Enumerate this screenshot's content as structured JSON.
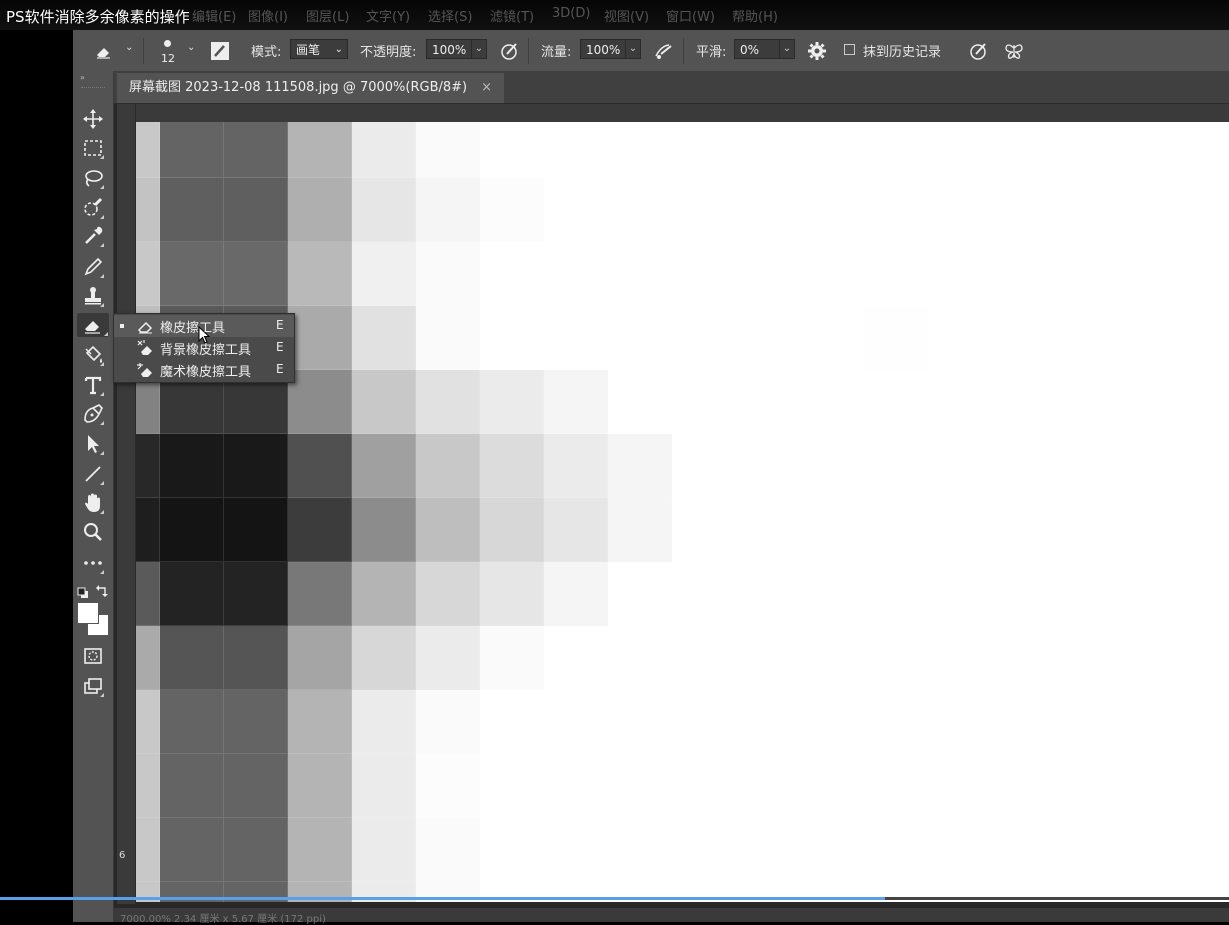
{
  "video_title": "PS软件消除多余像素的操作",
  "menu": {
    "items": [
      "编辑(E)",
      "图像(I)",
      "图层(L)",
      "文字(Y)",
      "选择(S)",
      "滤镜(T)",
      "3D(D)",
      "视图(V)",
      "窗口(W)",
      "帮助(H)"
    ]
  },
  "options_bar": {
    "brush_size": "12",
    "mode_label": "模式:",
    "mode_value": "画笔",
    "opacity_label": "不透明度:",
    "opacity_value": "100%",
    "flow_label": "流量:",
    "flow_value": "100%",
    "smoothing_label": "平滑:",
    "smoothing_value": "0%",
    "erase_history_label": "抹到历史记录",
    "erase_history_checked": false
  },
  "document_tab": {
    "title": "屏幕截图 2023-12-08 111508.jpg @ 7000%(RGB/8#)",
    "close": "×"
  },
  "flyout": {
    "items": [
      {
        "label": "橡皮擦工具",
        "shortcut": "E",
        "selected": true
      },
      {
        "label": "背景橡皮擦工具",
        "shortcut": "E",
        "selected": false
      },
      {
        "label": "魔术橡皮擦工具",
        "shortcut": "E",
        "selected": false
      }
    ]
  },
  "ruler": {
    "vertical_number": "6"
  },
  "status": {
    "text": "7000.00%    2.34 厘米 x 5.67 厘米 (172 ppi)"
  },
  "playback": {
    "progress": 0.72,
    "accent": "#5aa0e6"
  },
  "colors": {
    "foreground": "#ffffff",
    "background": "#ffffff"
  },
  "pixel_grid": {
    "rows": [
      [
        200,
        100,
        100,
        180,
        235,
        250,
        255,
        255,
        255,
        255,
        255,
        255,
        255,
        255,
        255,
        255,
        255,
        255
      ],
      [
        195,
        95,
        95,
        175,
        230,
        245,
        252,
        255,
        255,
        255,
        255,
        255,
        255,
        255,
        255,
        255,
        255,
        255
      ],
      [
        200,
        105,
        105,
        185,
        240,
        250,
        255,
        255,
        255,
        255,
        255,
        255,
        255,
        255,
        255,
        255,
        255,
        255
      ],
      [
        190,
        90,
        90,
        170,
        225,
        250,
        255,
        255,
        255,
        255,
        255,
        255,
        254,
        255,
        255,
        255,
        255,
        255
      ],
      [
        130,
        55,
        55,
        140,
        200,
        225,
        235,
        245,
        255,
        255,
        255,
        255,
        255,
        255,
        255,
        255,
        255,
        255
      ],
      [
        40,
        25,
        25,
        80,
        160,
        200,
        220,
        235,
        245,
        255,
        255,
        255,
        255,
        255,
        255,
        255,
        255,
        255
      ],
      [
        30,
        20,
        20,
        60,
        140,
        190,
        215,
        230,
        245,
        255,
        255,
        255,
        255,
        255,
        255,
        255,
        255,
        255
      ],
      [
        90,
        35,
        35,
        120,
        180,
        215,
        230,
        245,
        255,
        255,
        255,
        255,
        255,
        255,
        255,
        255,
        255,
        255
      ],
      [
        170,
        85,
        85,
        165,
        215,
        235,
        250,
        255,
        255,
        255,
        255,
        255,
        255,
        255,
        255,
        255,
        255,
        255
      ],
      [
        200,
        100,
        100,
        180,
        235,
        250,
        255,
        255,
        255,
        255,
        255,
        255,
        255,
        255,
        255,
        255,
        255,
        255
      ],
      [
        200,
        100,
        100,
        180,
        235,
        252,
        255,
        255,
        255,
        255,
        255,
        255,
        255,
        255,
        255,
        255,
        255,
        255
      ],
      [
        200,
        100,
        100,
        180,
        235,
        250,
        255,
        255,
        255,
        255,
        255,
        255,
        255,
        255,
        255,
        255,
        255,
        255
      ],
      [
        200,
        100,
        100,
        180,
        235,
        250,
        255,
        255,
        255,
        255,
        255,
        255,
        255,
        255,
        255,
        255,
        255,
        255
      ]
    ]
  }
}
